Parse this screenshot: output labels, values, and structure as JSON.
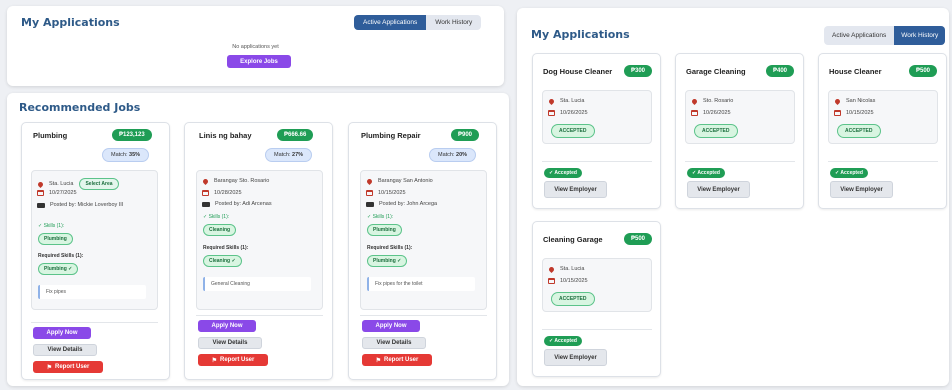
{
  "left_apps": {
    "title": "My Applications",
    "tabs": [
      "Active Applications",
      "Work History"
    ],
    "empty_text": "No applications yet",
    "explore_label": "Explore Jobs"
  },
  "recommended": {
    "title": "Recommended Jobs",
    "jobs": [
      {
        "title": "Plumbing",
        "price": "₱123,123",
        "match_label": "Match:",
        "match_value": "35%",
        "location": "Sta. Lucia",
        "location_badge": "Select Area",
        "date": "10/27/2025",
        "posted_by": "Posted by: Mickie Loverboy III",
        "skills_label": "✓ Skills (1):",
        "skill": "Plumbing",
        "required_label": "Required Skills (1):",
        "required_skill": "Plumbing ✓",
        "description": "Fix pipes",
        "apply_label": "Apply Now",
        "view_label": "View Details",
        "report_label": "Report User"
      },
      {
        "title": "Linis ng bahay",
        "price": "₱666.66",
        "match_label": "Match:",
        "match_value": "27%",
        "location": "Barangay Sto. Rosario",
        "date": "10/28/2025",
        "posted_by": "Posted by: Adi Arcenas",
        "skills_label": "✓ Skills (1):",
        "skill": "Cleaning",
        "required_label": "Required Skills (1):",
        "required_skill": "Cleaning ✓",
        "description": "General Cleaning",
        "apply_label": "Apply Now",
        "view_label": "View Details",
        "report_label": "Report User"
      },
      {
        "title": "Plumbing Repair",
        "price": "₱900",
        "match_label": "Match:",
        "match_value": "20%",
        "location": "Barangay San Antonio",
        "date": "10/15/2025",
        "posted_by": "Posted by: John Arcega",
        "skills_label": "✓ Skills (1):",
        "skill": "Plumbing",
        "required_label": "Required Skills (1):",
        "required_skill": "Plumbing ✓",
        "description": "Fix pipes for the toilet",
        "apply_label": "Apply Now",
        "view_label": "View Details",
        "report_label": "Report User"
      }
    ]
  },
  "right_apps": {
    "title": "My Applications",
    "tabs": [
      "Active Applications",
      "Work History"
    ],
    "cards": [
      {
        "title": "Dog House Cleaner",
        "price": "₱300",
        "location": "Sta. Lucia",
        "date": "10/26/2025",
        "status": "ACCEPTED",
        "accepted": "✓ Accepted",
        "view_label": "View Employer"
      },
      {
        "title": "Garage Cleaning",
        "price": "₱400",
        "location": "Sto. Rosario",
        "date": "10/26/2025",
        "status": "ACCEPTED",
        "accepted": "✓ Accepted",
        "view_label": "View Employer"
      },
      {
        "title": "House Cleaner",
        "price": "₱500",
        "location": "San Nicolas",
        "date": "10/15/2025",
        "status": "ACCEPTED",
        "accepted": "✓ Accepted",
        "view_label": "View Employer"
      },
      {
        "title": "Cleaning Garage",
        "price": "₱500",
        "location": "Sta. Lucia",
        "date": "10/15/2025",
        "status": "ACCEPTED",
        "accepted": "✓ Accepted",
        "view_label": "View Employer"
      }
    ]
  },
  "colors": {
    "brand_blue": "#2f5d9a",
    "purple": "#8a49e8",
    "green": "#1f9d55",
    "red": "#e53935"
  }
}
